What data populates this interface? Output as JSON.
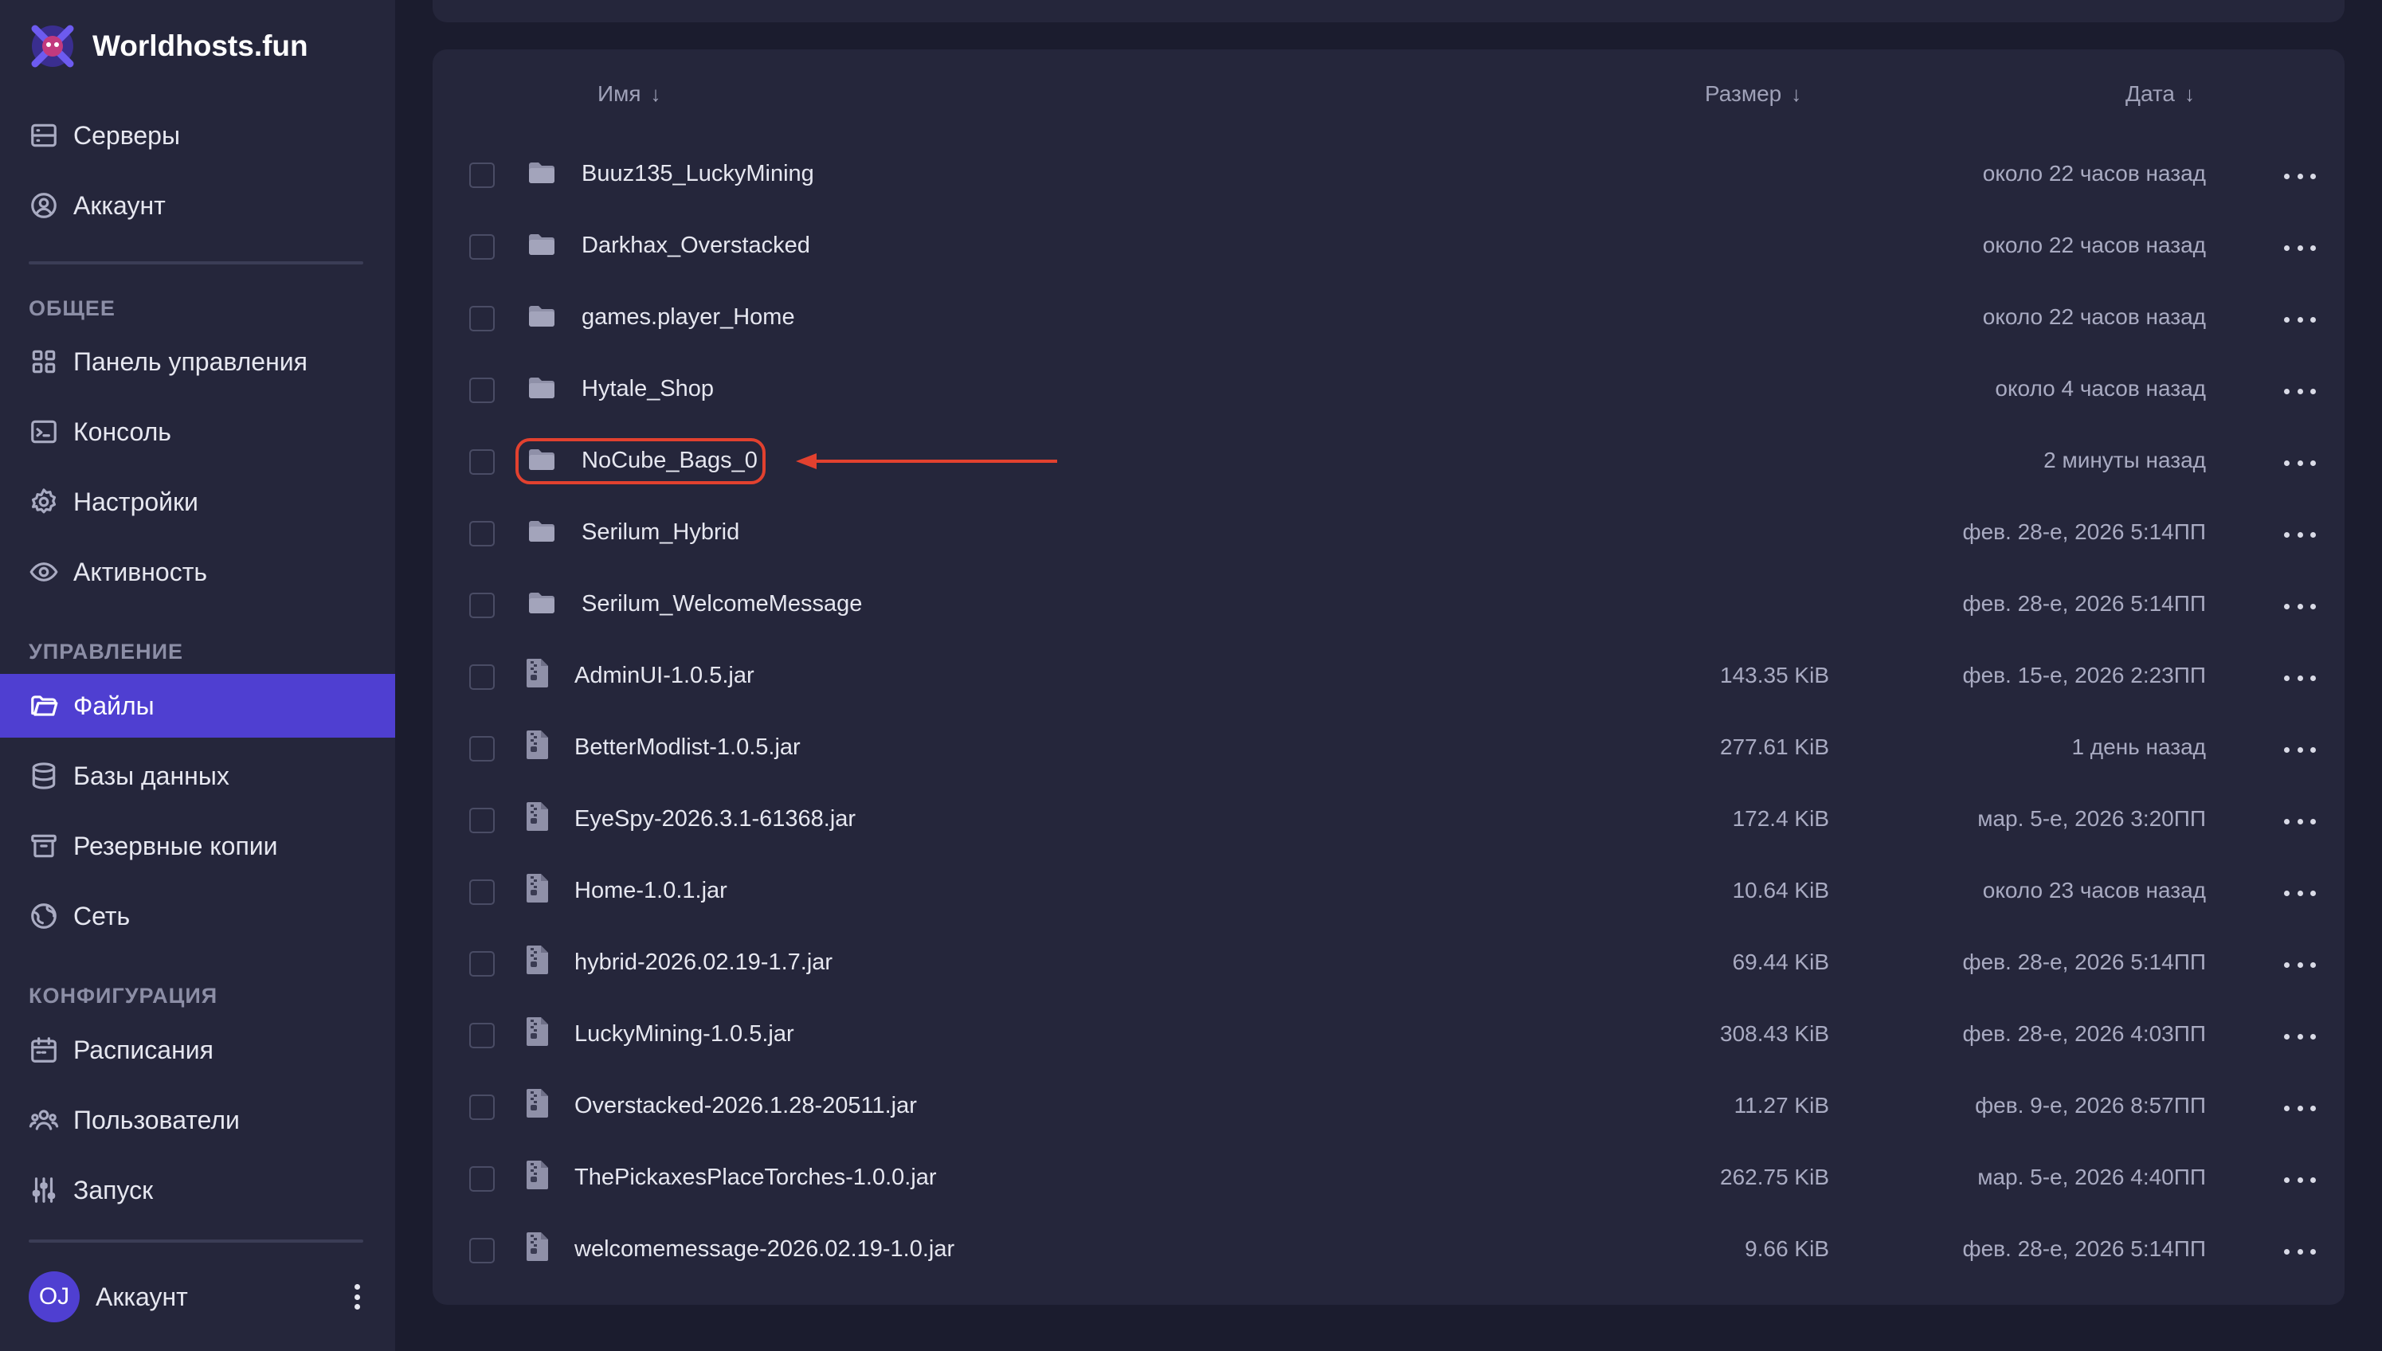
{
  "app": {
    "name": "Worldhosts.fun"
  },
  "sidebar": {
    "top_items": [
      {
        "label": "Серверы",
        "icon": "server-icon"
      },
      {
        "label": "Аккаунт",
        "icon": "user-circle-icon"
      }
    ],
    "sections": [
      {
        "title": "ОБЩЕЕ",
        "items": [
          {
            "label": "Панель управления",
            "icon": "dashboard-grid-icon"
          },
          {
            "label": "Консоль",
            "icon": "terminal-icon"
          },
          {
            "label": "Настройки",
            "icon": "gear-icon"
          },
          {
            "label": "Активность",
            "icon": "eye-icon"
          }
        ]
      },
      {
        "title": "УПРАВЛЕНИЕ",
        "items": [
          {
            "label": "Файлы",
            "icon": "folder-open-icon",
            "active": true
          },
          {
            "label": "Базы данных",
            "icon": "database-icon"
          },
          {
            "label": "Резервные копии",
            "icon": "archive-icon"
          },
          {
            "label": "Сеть",
            "icon": "globe-icon"
          }
        ]
      },
      {
        "title": "КОНФИГУРАЦИЯ",
        "items": [
          {
            "label": "Расписания",
            "icon": "calendar-icon"
          },
          {
            "label": "Пользователи",
            "icon": "users-icon"
          },
          {
            "label": "Запуск",
            "icon": "sliders-icon"
          }
        ]
      }
    ],
    "account": {
      "initials": "OJ",
      "label": "Аккаунт"
    }
  },
  "files": {
    "headers": {
      "name": "Имя",
      "size": "Размер",
      "date": "Дата",
      "sort_arrow": "↓"
    },
    "rows": [
      {
        "type": "folder",
        "name": "Buuz135_LuckyMining",
        "size": "",
        "date": "около 22 часов назад"
      },
      {
        "type": "folder",
        "name": "Darkhax_Overstacked",
        "size": "",
        "date": "около 22 часов назад"
      },
      {
        "type": "folder",
        "name": "games.player_Home",
        "size": "",
        "date": "около 22 часов назад"
      },
      {
        "type": "folder",
        "name": "Hytale_Shop",
        "size": "",
        "date": "около 4 часов назад"
      },
      {
        "type": "folder",
        "name": "NoCube_Bags_0",
        "size": "",
        "date": "2 минуты назад",
        "highlighted": true
      },
      {
        "type": "folder",
        "name": "Serilum_Hybrid",
        "size": "",
        "date": "фев. 28-е, 2026 5:14ПП"
      },
      {
        "type": "folder",
        "name": "Serilum_WelcomeMessage",
        "size": "",
        "date": "фев. 28-е, 2026 5:14ПП"
      },
      {
        "type": "file",
        "name": "AdminUI-1.0.5.jar",
        "size": "143.35 KiB",
        "date": "фев. 15-е, 2026 2:23ПП"
      },
      {
        "type": "file",
        "name": "BetterModlist-1.0.5.jar",
        "size": "277.61 KiB",
        "date": "1 день назад"
      },
      {
        "type": "file",
        "name": "EyeSpy-2026.3.1-61368.jar",
        "size": "172.4 KiB",
        "date": "мар. 5-е, 2026 3:20ПП"
      },
      {
        "type": "file",
        "name": "Home-1.0.1.jar",
        "size": "10.64 KiB",
        "date": "около 23 часов назад"
      },
      {
        "type": "file",
        "name": "hybrid-2026.02.19-1.7.jar",
        "size": "69.44 KiB",
        "date": "фев. 28-е, 2026 5:14ПП"
      },
      {
        "type": "file",
        "name": "LuckyMining-1.0.5.jar",
        "size": "308.43 KiB",
        "date": "фев. 28-е, 2026 4:03ПП"
      },
      {
        "type": "file",
        "name": "Overstacked-2026.1.28-20511.jar",
        "size": "11.27 KiB",
        "date": "фев. 9-е, 2026 8:57ПП"
      },
      {
        "type": "file",
        "name": "ThePickaxesPlaceTorches-1.0.0.jar",
        "size": "262.75 KiB",
        "date": "мар. 5-е, 2026 4:40ПП"
      },
      {
        "type": "file",
        "name": "welcomemessage-2026.02.19-1.0.jar",
        "size": "9.66 KiB",
        "date": "фев. 28-е, 2026 5:14ПП"
      }
    ]
  },
  "colors": {
    "sidebar_bg": "#25263b",
    "page_bg": "#1b1c2e",
    "accent": "#4f3fd1",
    "annotation": "#e2412f"
  }
}
